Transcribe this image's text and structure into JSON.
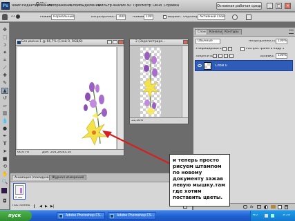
{
  "app": {
    "logo": "Ps",
    "zoom": "66,7",
    "workspace_button": "Основная рабочая среда",
    "window_controls": [
      "_",
      "□",
      "×"
    ]
  },
  "menu": {
    "items": [
      "Файл",
      "Редактирование",
      "Изображение",
      "Слои",
      "Выделение",
      "Фильтр",
      "Анализ",
      "3D",
      "Просмотр",
      "Окно",
      "Справка"
    ]
  },
  "options": {
    "brush_size": "21",
    "mode_label": "Режим:",
    "mode_value": "Нормальный",
    "opacity_label": "Непрозрачность:",
    "opacity_value": "100%",
    "pressure_label": "Нажим:",
    "pressure_value": "100%",
    "aligned_label": "Выравн.",
    "sample_label": "Образец:",
    "sample_value": "Активный слой"
  },
  "doc1": {
    "title": "Без имени-1 @ 66,7% (Слой 0, RGB/8)",
    "zoom": "66,67%",
    "status": "Док: 264,2K/83,5K"
  },
  "doc2": {
    "title": "2 (Зарегистриро...",
    "zoom": "55,16%"
  },
  "layers_panel": {
    "tabs": [
      "Слои",
      "Каналы",
      "Контуры"
    ],
    "blend_mode": "Обычные",
    "opacity_label": "Непрозрачность:",
    "opacity_value": "100%",
    "lock_label": "Закрепить:",
    "fill_label": "Заливка:",
    "fill_value": "100%",
    "normalize_label": "Унифицировать:",
    "spread_label": "Распространить кадр 1",
    "layer_name": "Слой 0"
  },
  "anim_panel": {
    "tabs": [
      "Анимация (покадровая)",
      "Журнал измерений"
    ],
    "frame_time": "0 сек.",
    "loop": "Постоянно"
  },
  "note": {
    "text": "и теперь просто рисуем штампом по новому документу зажав левую мышку.там где хотим поставить цветы."
  },
  "taskbar": {
    "start": "пуск",
    "items": [
      "Adobe Photoshop CS...",
      "Adobe Photoshop CS..."
    ],
    "clock": "9:39",
    "lang": "RU"
  },
  "colors": {
    "accent": "#2e5cb8",
    "arrow": "#d42020",
    "foreground_swatch": "#3a1060"
  }
}
